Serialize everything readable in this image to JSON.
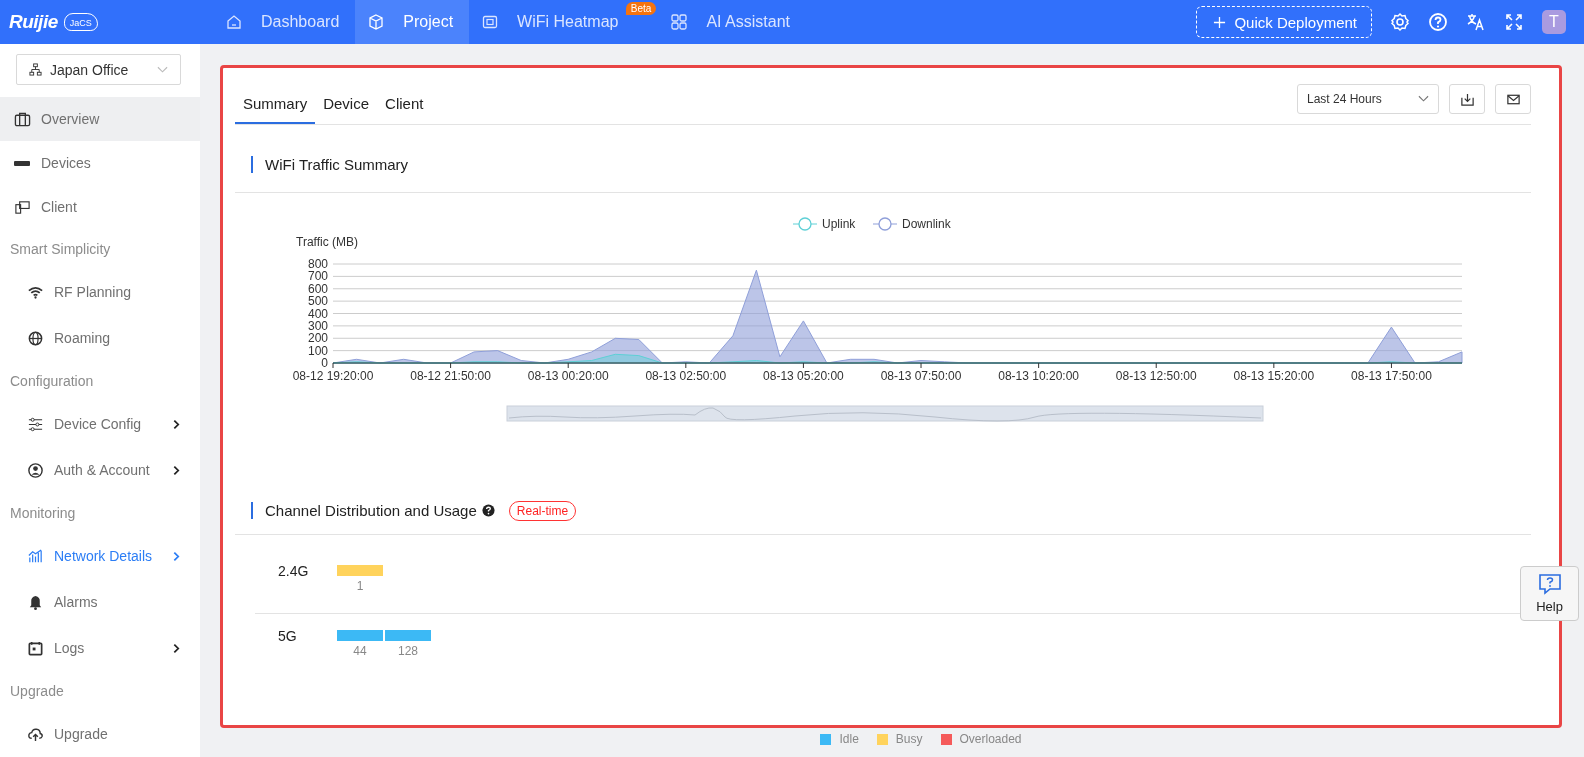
{
  "top_bar": {
    "logo": {
      "brand": "Ruijie",
      "product": "JaCS"
    },
    "nav": [
      {
        "label": "Dashboard",
        "selected": false
      },
      {
        "label": "Project",
        "selected": true
      },
      {
        "label": "WiFi Heatmap",
        "selected": false,
        "badge": "Beta"
      },
      {
        "label": "AI Assistant",
        "selected": false
      }
    ],
    "quick_deployment": "Quick Deployment",
    "avatar": "T"
  },
  "sidebar": {
    "site": "Japan Office",
    "items": [
      {
        "kind": "item",
        "label": "Overview",
        "selected": false,
        "highlighted": true,
        "has_submenu": false
      },
      {
        "kind": "item",
        "label": "Devices",
        "selected": false,
        "highlighted": false,
        "has_submenu": false
      },
      {
        "kind": "item",
        "label": "Client",
        "selected": false,
        "highlighted": false,
        "has_submenu": false
      },
      {
        "kind": "section",
        "label": "Smart Simplicity"
      },
      {
        "kind": "subitem",
        "label": "RF Planning",
        "selected": false,
        "highlighted": false,
        "has_submenu": false
      },
      {
        "kind": "subitem",
        "label": "Roaming",
        "selected": false,
        "highlighted": false,
        "has_submenu": false
      },
      {
        "kind": "section",
        "label": "Configuration"
      },
      {
        "kind": "subitem",
        "label": "Device Config",
        "selected": false,
        "highlighted": false,
        "has_submenu": true
      },
      {
        "kind": "subitem",
        "label": "Auth & Account",
        "selected": false,
        "highlighted": false,
        "has_submenu": true
      },
      {
        "kind": "section",
        "label": "Monitoring"
      },
      {
        "kind": "subitem",
        "label": "Network Details",
        "selected": true,
        "highlighted": false,
        "has_submenu": true
      },
      {
        "kind": "subitem",
        "label": "Alarms",
        "selected": false,
        "highlighted": false,
        "has_submenu": false
      },
      {
        "kind": "subitem",
        "label": "Logs",
        "selected": false,
        "highlighted": false,
        "has_submenu": true
      },
      {
        "kind": "section",
        "label": "Upgrade"
      },
      {
        "kind": "subitem",
        "label": "Upgrade",
        "selected": false,
        "highlighted": false,
        "has_submenu": false
      }
    ]
  },
  "tabs": [
    {
      "label": "Summary",
      "selected": true
    },
    {
      "label": "Device",
      "selected": false
    },
    {
      "label": "Client",
      "selected": false
    }
  ],
  "time_range": "Last 24 Hours",
  "traffic": {
    "title": "WiFi Traffic Summary",
    "chart_data": {
      "type": "area",
      "ylabel": "Traffic (MB)",
      "categories": [
        "08-12 19:20:00",
        null,
        null,
        null,
        null,
        "08-12 21:50:00",
        null,
        null,
        null,
        null,
        "08-13 00:20:00",
        null,
        null,
        null,
        null,
        "08-13 02:50:00",
        null,
        null,
        null,
        null,
        "08-13 05:20:00",
        null,
        null,
        null,
        null,
        "08-13 07:50:00",
        null,
        null,
        null,
        null,
        "08-13 10:20:00",
        null,
        null,
        null,
        null,
        "08-13 12:50:00",
        null,
        null,
        null,
        null,
        "08-13 15:20:00",
        null,
        null,
        null,
        null,
        "08-13 17:50:00",
        null,
        null,
        null
      ],
      "series": [
        {
          "name": "Uplink",
          "color": "#5ed0d6",
          "values": [
            0,
            10,
            0,
            0,
            0,
            0,
            10,
            10,
            0,
            0,
            10,
            20,
            70,
            60,
            0,
            0,
            0,
            10,
            20,
            0,
            10,
            0,
            0,
            10,
            0,
            0,
            0,
            0,
            0,
            0,
            0,
            0,
            0,
            0,
            0,
            0,
            0,
            0,
            0,
            0,
            0,
            0,
            0,
            0,
            0,
            10,
            0,
            0,
            0
          ]
        },
        {
          "name": "Downlink",
          "color": "#8f9fd9",
          "values": [
            0,
            30,
            0,
            30,
            0,
            0,
            90,
            100,
            20,
            0,
            30,
            90,
            200,
            190,
            0,
            10,
            0,
            220,
            750,
            50,
            340,
            0,
            30,
            30,
            0,
            20,
            10,
            0,
            0,
            0,
            0,
            0,
            0,
            0,
            0,
            0,
            0,
            0,
            0,
            0,
            0,
            0,
            0,
            0,
            0,
            290,
            0,
            10,
            90
          ]
        }
      ],
      "ylim": [
        0,
        800
      ],
      "yticks": [
        0,
        100,
        200,
        300,
        400,
        500,
        600,
        700,
        800
      ],
      "grid": true,
      "legend": true
    }
  },
  "channels": {
    "title": "Channel Distribution and Usage",
    "badge": "Real-time",
    "rows": [
      {
        "band": "2.4G",
        "channels": [
          {
            "number": "1",
            "color": "#ffd35c"
          }
        ]
      },
      {
        "band": "5G",
        "channels": [
          {
            "number": "44",
            "color": "#3cb9f5"
          },
          {
            "number": "128",
            "color": "#3cb9f5"
          }
        ]
      }
    ],
    "legend": [
      {
        "label": "Idle",
        "color": "#3cb9f5"
      },
      {
        "label": "Busy",
        "color": "#ffd35c"
      },
      {
        "label": "Overloaded",
        "color": "#f55a5a"
      }
    ]
  },
  "help": "Help"
}
